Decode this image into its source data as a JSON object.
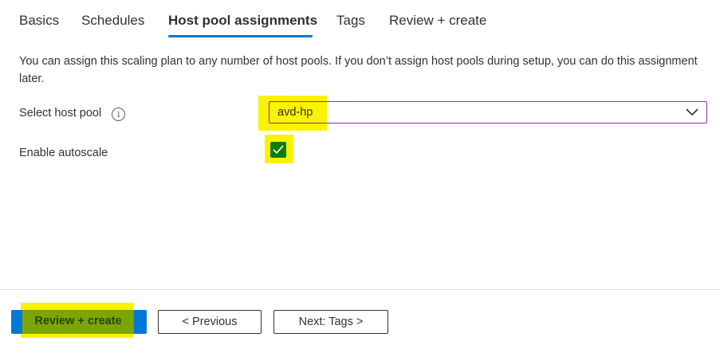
{
  "tabs": [
    {
      "label": "Basics"
    },
    {
      "label": "Schedules"
    },
    {
      "label": "Host pool assignments",
      "active": true
    },
    {
      "label": "Tags"
    },
    {
      "label": "Review + create"
    }
  ],
  "description": "You can assign this scaling plan to any number of host pools. If you don’t assign host pools during setup, you can do this assignment later.",
  "form": {
    "host_pool_label": "Select host pool",
    "info_icon": "info-icon",
    "host_pool_value": "avd-hp",
    "autoscale_label": "Enable autoscale",
    "autoscale_checked": true
  },
  "footer": {
    "review_create_label": "Review + create",
    "previous_label": "< Previous",
    "next_label": "Next: Tags >"
  },
  "colors": {
    "accent": "#0078d4",
    "highlight": "#f9f200",
    "checkbox": "#107c10",
    "dropdown_border": "#8a2da5"
  }
}
